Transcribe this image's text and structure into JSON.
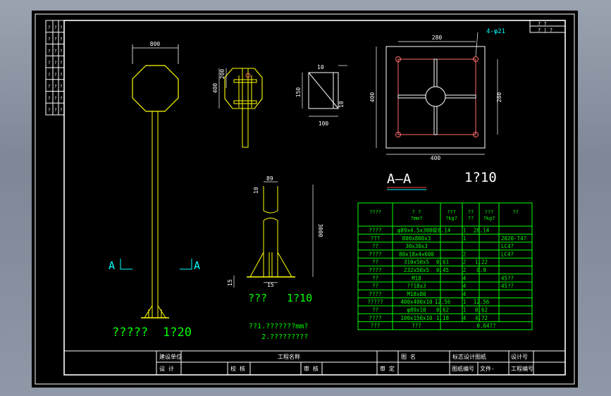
{
  "colors": {
    "frame": "#ffffff",
    "sign": "#ffff00",
    "table": "#00ff00",
    "annot": "#00ffff",
    "hole": "#ff6b6b",
    "title_text": "#00ff00"
  },
  "drawing": {
    "sign_width": "800",
    "bracket_400": "400",
    "bracket_200": "200",
    "stiff_10": "10",
    "stiff_150": "150",
    "stiff_100": "100",
    "stiff_t": "10",
    "post_89": "89",
    "post_10": "10",
    "post_3000": "3000",
    "post_15": "15",
    "post_15b": "15",
    "section_A_left": "A",
    "section_A_right": "A",
    "plate_280_top": "280",
    "plate_holes": "4-φ21",
    "plate_400_left": "400",
    "plate_280_right": "280",
    "plate_400_bottom": "400",
    "aa_label": "A—A",
    "aa_scale": "1?10",
    "elev_label": "?????",
    "elev_scale": "1?20",
    "post_label": "???",
    "post_scale": "1?10",
    "note1": "??1.???????mm?",
    "note2": "2.?????????"
  },
  "bom": {
    "headers": [
      "????",
      "? ?\n?mm?",
      "???\n?kg?",
      "??\n??",
      "???\n?kg?",
      "??"
    ],
    "rows": [
      [
        "????",
        "φ89x4.5x3000",
        "28.14",
        "1",
        "28.14",
        ""
      ],
      [
        "???",
        "800x800x3",
        "",
        "1",
        "",
        "2020-T4?"
      ],
      [
        "??",
        "30x30x3",
        "",
        "",
        "",
        "LC4?"
      ],
      [
        "????",
        "80x18x4x600",
        "",
        "2",
        "",
        "LC4?"
      ],
      [
        "??",
        "310x50x5",
        "0.61",
        "2",
        "1.22",
        ""
      ],
      [
        "????",
        "232x50x5",
        "0.45",
        "2",
        "0.9",
        ""
      ],
      [
        "??",
        "M18",
        "",
        "4",
        "",
        "45??"
      ],
      [
        "??",
        "??18x3",
        "",
        "4",
        "",
        "45??"
      ],
      [
        "????",
        "M18x80",
        "",
        "4",
        "",
        ""
      ],
      [
        "?????",
        "400x400x10",
        "12.56",
        "1",
        "12.56",
        ""
      ],
      [
        "??",
        "φ89x10",
        "0.62",
        "1",
        "0.62",
        ""
      ],
      [
        "????",
        "100x150x10",
        "1.18",
        "4",
        "4.72",
        ""
      ]
    ],
    "total_label": "???",
    "total_sub": "???",
    "total_value": "0.64??"
  },
  "title_block": {
    "row1": [
      "建设单位",
      "工程名称",
      "图 名",
      "标志设计图纸",
      "设计号"
    ],
    "row2": [
      "设 计",
      "校 核",
      "审 核",
      "审 定",
      "图纸编号",
      "文件-",
      "工程编号"
    ]
  },
  "revision_box": {
    "a": "? ?",
    "b": "? | ?"
  },
  "left_strip": [
    [
      "?",
      "?",
      "?"
    ],
    [
      "?",
      "?",
      "?"
    ],
    [
      "?",
      "?",
      "?"
    ],
    [
      "?",
      "?",
      "?"
    ],
    [
      "?",
      "?",
      "?"
    ],
    [
      "?",
      "?",
      "?"
    ],
    [
      "?",
      "?",
      "?"
    ],
    [
      "?",
      "?",
      "?"
    ]
  ]
}
